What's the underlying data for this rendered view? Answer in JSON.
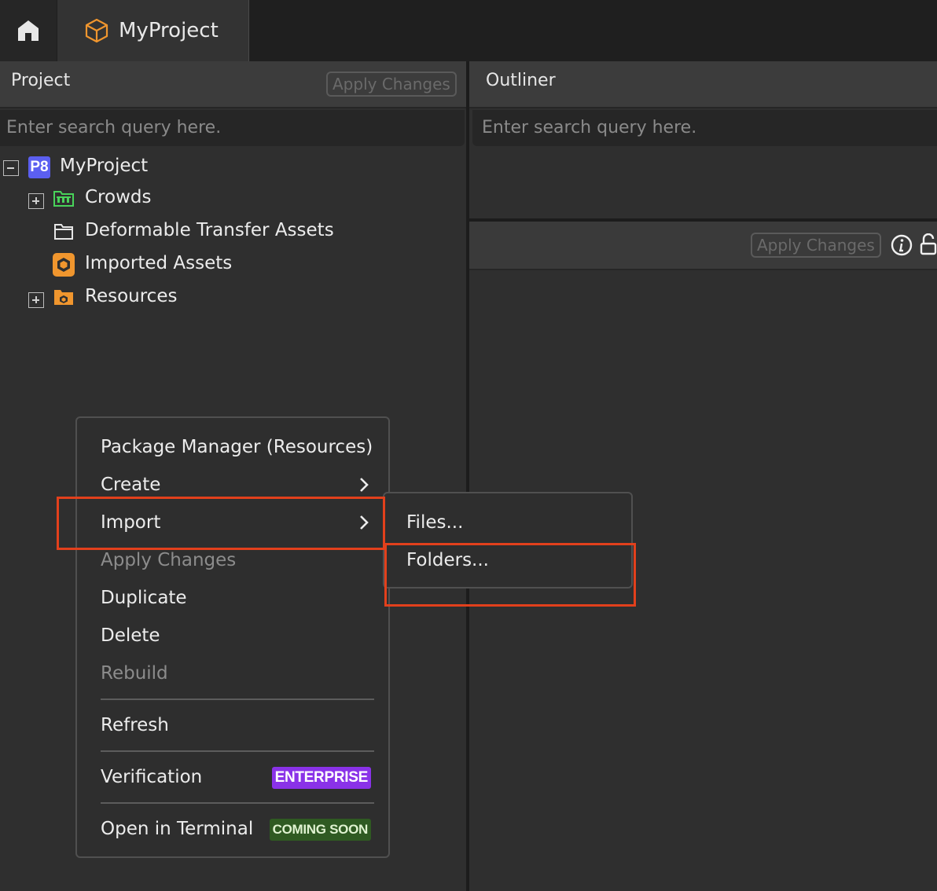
{
  "topbar": {
    "home_icon": "home-icon",
    "project_tab_label": "MyProject",
    "project_tab_icon": "cube-icon"
  },
  "project_panel": {
    "title": "Project",
    "apply_label": "Apply Changes",
    "search_placeholder": "Enter search query here.",
    "tree": [
      {
        "label": "MyProject",
        "icon": "p8-badge-icon",
        "badge_text": "P8",
        "expanded": true
      },
      {
        "label": "Crowds",
        "icon": "green-folder-icon",
        "expanded": false
      },
      {
        "label": "Deformable Transfer Assets",
        "icon": "folder-outline-icon"
      },
      {
        "label": "Imported Assets",
        "icon": "hexagon-package-icon"
      },
      {
        "label": "Resources",
        "icon": "orange-folder-icon",
        "expanded": false
      }
    ]
  },
  "outliner_panel": {
    "title": "Outliner",
    "search_placeholder": "Enter search query here."
  },
  "properties_panel": {
    "apply_label": "Apply Changes",
    "info_icon": "info-icon",
    "lock_icon": "lock-icon"
  },
  "context_menu": {
    "items": [
      {
        "label": "Package Manager (Resources)",
        "enabled": true
      },
      {
        "label": "Create",
        "enabled": true,
        "submenu": true
      },
      {
        "label": "Import",
        "enabled": true,
        "submenu": true
      },
      {
        "label": "Apply Changes",
        "enabled": false
      },
      {
        "label": "Duplicate",
        "enabled": true
      },
      {
        "label": "Delete",
        "enabled": true
      },
      {
        "label": "Rebuild",
        "enabled": false
      },
      {
        "label": "Refresh",
        "enabled": true
      },
      {
        "label": "Verification",
        "enabled": true,
        "badge": "ENTERPRISE"
      },
      {
        "label": "Open in Terminal",
        "enabled": true,
        "badge": "COMING SOON"
      }
    ]
  },
  "import_submenu": {
    "items": [
      {
        "label": "Files..."
      },
      {
        "label": "Folders..."
      }
    ]
  },
  "colors": {
    "highlight": "#e2401c",
    "enterprise_badge": "#8a32e8",
    "coming_soon_badge": "#2f5a22",
    "p8_badge": "#5b5ff0",
    "package_orange": "#f0962e",
    "crowds_green": "#49d35a"
  }
}
